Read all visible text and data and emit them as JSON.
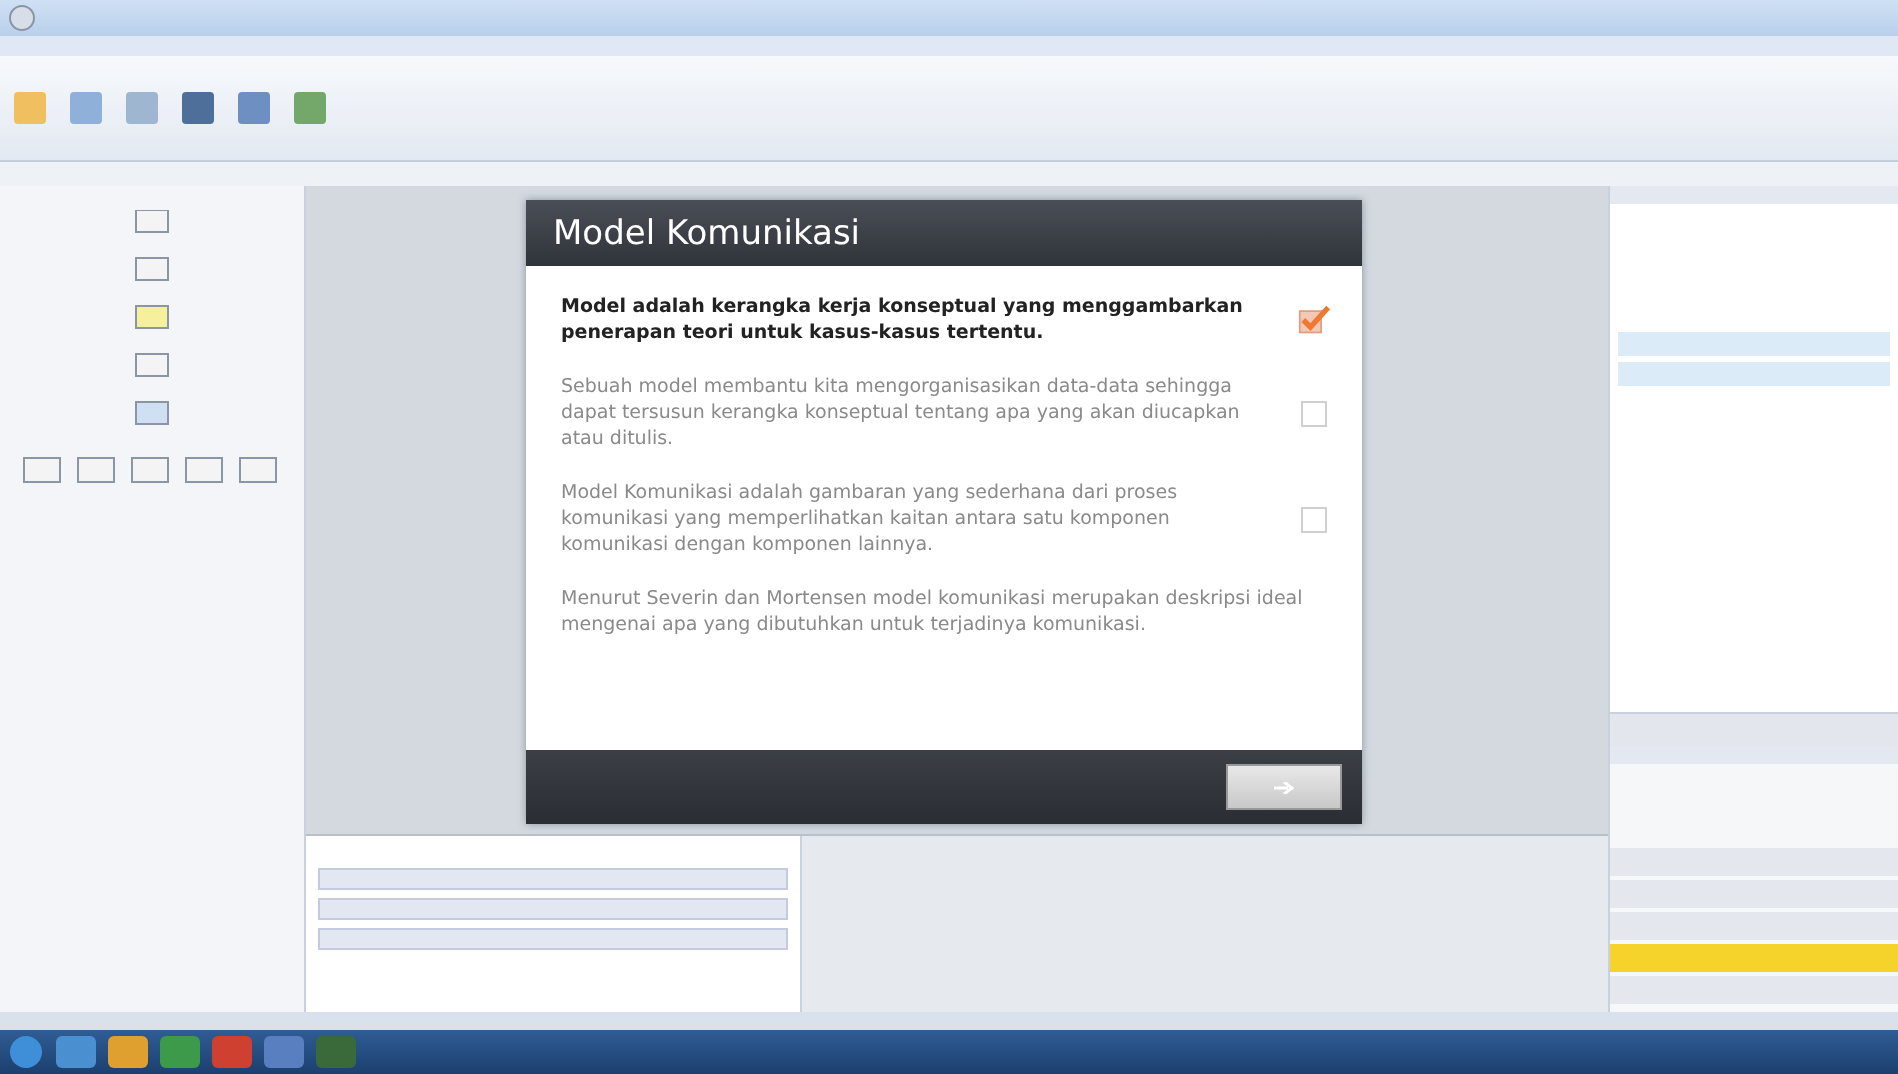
{
  "slide": {
    "title": "Model Komunikasi",
    "items": [
      {
        "kind": "choice",
        "text": "Model adalah kerangka kerja konseptual yang menggambarkan penerapan teori untuk kasus-kasus tertentu.",
        "checked": true
      },
      {
        "kind": "choice",
        "text": "Sebuah model membantu kita mengorganisasikan data-data sehingga dapat tersusun kerangka konseptual tentang apa yang akan diucapkan atau ditulis.",
        "checked": false
      },
      {
        "kind": "choice",
        "text": "Model Komunikasi adalah gambaran yang sederhana dari proses komunikasi yang memperlihatkan kaitan antara satu komponen komunikasi dengan komponen lainnya.",
        "checked": false
      },
      {
        "kind": "text",
        "text": "Menurut Severin dan Mortensen model komunikasi merupakan deskripsi ideal mengenai apa yang dibutuhkan untuk terjadinya komunikasi."
      }
    ]
  }
}
